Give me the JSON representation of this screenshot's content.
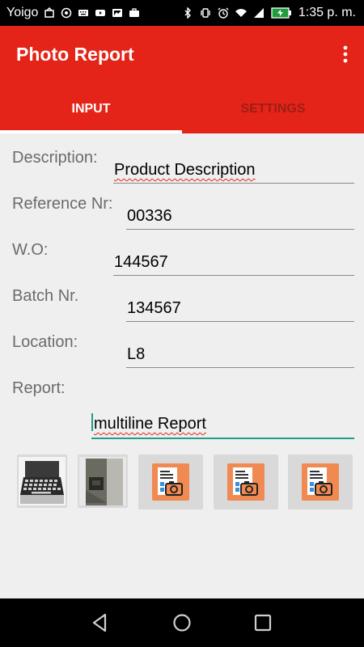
{
  "status_bar": {
    "carrier": "Yoigo",
    "time": "1:35 p. m.",
    "icons": [
      "sim-icon",
      "whatsapp-icon",
      "keyboard-icon",
      "youtube-icon",
      "photo-icon",
      "briefcase-icon",
      "bluetooth-icon",
      "vibrate-icon",
      "alarm-icon",
      "wifi-icon",
      "signal-icon",
      "battery-icon"
    ]
  },
  "app_bar": {
    "title": "Photo Report",
    "menu_icon": "more-vert-icon"
  },
  "tabs": [
    {
      "label": "INPUT",
      "selected": true
    },
    {
      "label": "SETTINGS",
      "selected": false
    }
  ],
  "form": {
    "description": {
      "label": "Description:",
      "value": "Product Description"
    },
    "reference": {
      "label": "Reference Nr:",
      "value": "00336"
    },
    "wo": {
      "label": "W.O:",
      "value": "144567"
    },
    "batch": {
      "label": "Batch Nr.",
      "value": "134567"
    },
    "location": {
      "label": "Location:",
      "value": "L8"
    },
    "report": {
      "label": "Report:",
      "value": "multiline Report"
    }
  },
  "photos": {
    "items": [
      "laptop-photo",
      "device-photo",
      "add-photo-icon",
      "add-photo-icon",
      "add-photo-icon"
    ]
  },
  "nav_bar": {
    "icons": [
      "back-icon",
      "home-icon",
      "recents-icon"
    ]
  },
  "colors": {
    "primary": "#e52419",
    "accent": "#1e9e8c",
    "background": "#efefef"
  }
}
